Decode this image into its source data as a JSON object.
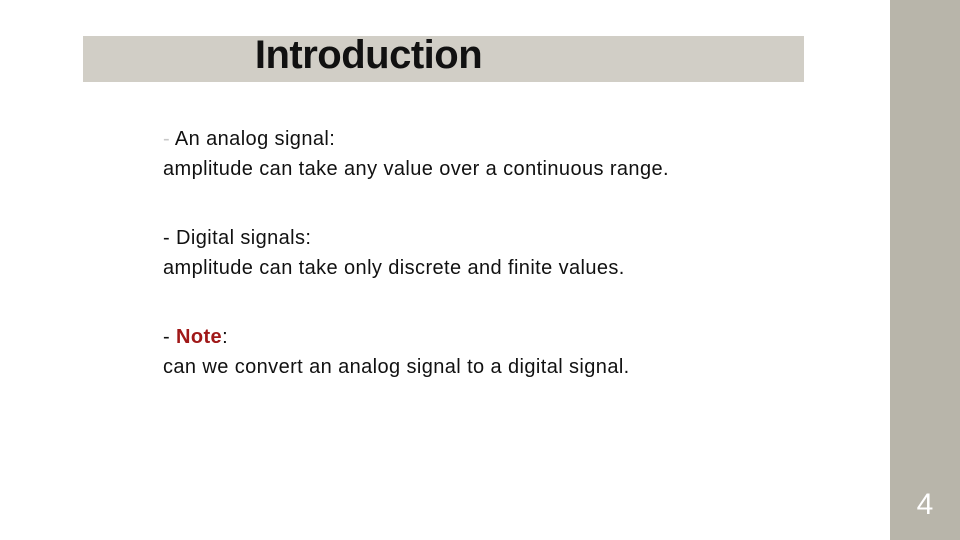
{
  "slide": {
    "title": "Introduction",
    "page_number": "4",
    "colors": {
      "title_bar": "#d1cec6",
      "side_bar": "#b8b5aa",
      "note_accent": "#a01818"
    },
    "paragraphs": [
      {
        "dash": "-",
        "heading": " An analog signal:",
        "body": "amplitude can take any value over a continuous range."
      },
      {
        "dash": "- ",
        "heading": "Digital signals:",
        "body": "amplitude can take only discrete and finite values."
      },
      {
        "dash": "- ",
        "keyword": "Note",
        "heading_suffix": ":",
        "body": "can we convert an analog signal to a digital signal."
      }
    ]
  }
}
